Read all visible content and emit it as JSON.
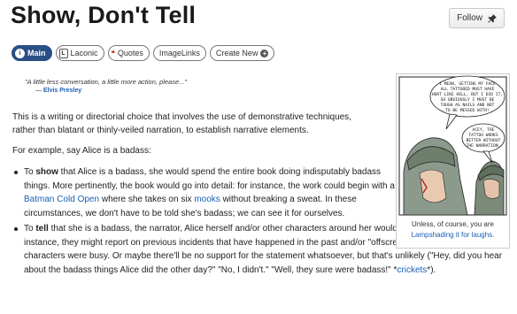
{
  "page": {
    "title": "Show, Don't Tell",
    "follow_label": "Follow"
  },
  "tabs": [
    {
      "label": "Main",
      "icon": "info-icon",
      "active": true
    },
    {
      "label": "Laconic",
      "icon": "laconic-icon"
    },
    {
      "label": "Quotes",
      "icon": "quote-marks-icon"
    },
    {
      "label": "ImageLinks"
    },
    {
      "label": "Create New",
      "icon": "plus-icon"
    }
  ],
  "quote": {
    "text": "\"A little less conversation, a little more action, please...\"",
    "dash": "—",
    "author": "Elvis Presley"
  },
  "intro": {
    "line1": "This is a writing or directorial choice that involves the use of demonstrative techniques,",
    "line2": "rather than blatant or thinly-veiled narration, to establish narrative elements."
  },
  "example_line": "For example, say Alice is a badass:",
  "bullet_show": {
    "prefix": "To ",
    "bold": "show",
    "text1": " that Alice is a badass, she would spend the entire book doing indisputably badass things. More pertinently, the book would go into detail: for instance, the work could begin with a ",
    "link1": "Batman Cold Open",
    "text2": " where she takes on six ",
    "link2": "mooks",
    "text3": " without breaking a sweat. In these circumstances, we don't have to be told she's badass; we can see it for ourselves."
  },
  "bullet_tell": {
    "prefix": "To ",
    "bold": "tell",
    "text1": " that she is a badass, the narrator, Alice herself and/or other characters around her would merely state that fact. For instance, they might report on previous incidents that have happened in the past and/or \"offscreen\" while the other characters were busy. Or maybe there'll be no support for the statement whatsoever, but that's unlikely (\"Hey, did you hear about the badass things Alice did the other day?\" \"No, I didn't.\" \"Well, they sure were badass!\" *",
    "link1": "crickets",
    "text2": "*)."
  },
  "comic": {
    "bubble1": [
      "I MEAN, GETTING MY FACE",
      "ALL TATTOOED MUST HAVE",
      "HURT LIKE HELL, BUT I DID IT,",
      "SO OBVIOUSLY I MUST BE",
      "TOUGH AS NAILS AND NOT",
      "TO BE MESSED WITH!"
    ],
    "bubble2": [
      "ACEY, THE",
      "TATTOO WORKS",
      "BETTER WITHOUT",
      "THE NARRATION."
    ]
  },
  "caption": {
    "text": "Unless, of course, you are",
    "link": "Lampshading it for laughs."
  },
  "colors": {
    "link": "#1a5fb4",
    "active_tab": "#2a4e86"
  }
}
